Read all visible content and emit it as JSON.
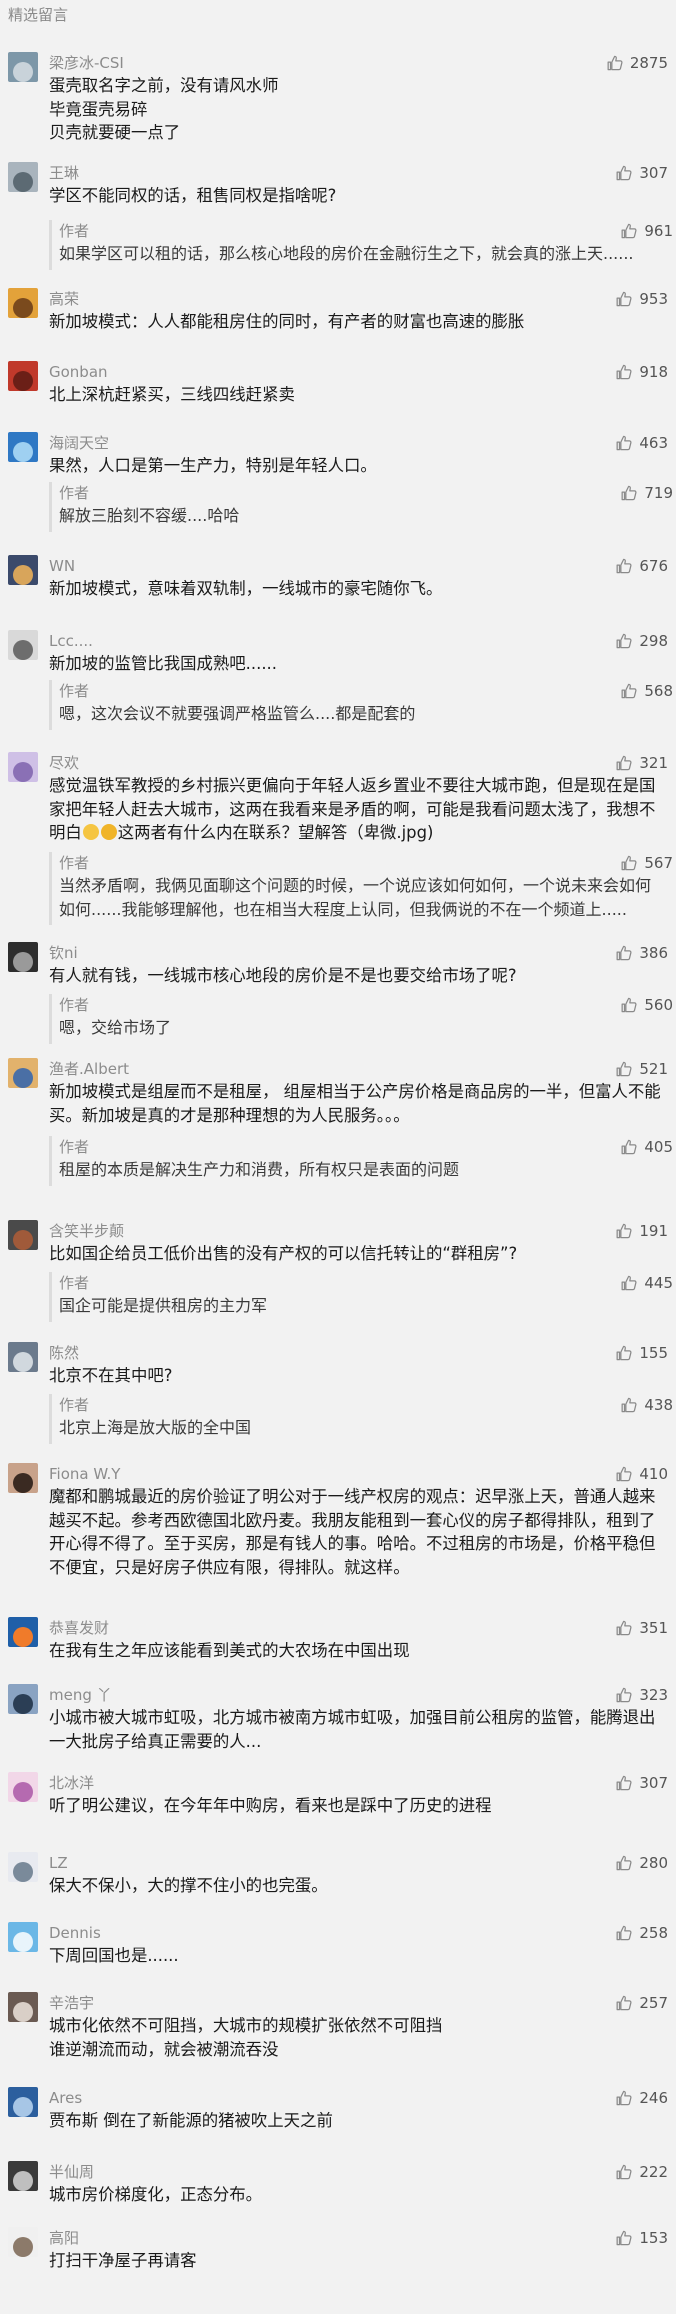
{
  "section_title": "精选留言",
  "comments": [
    {
      "name": "梁彦冰-CSI",
      "likes": "2875",
      "lines": [
        "蛋壳取名字之前，没有请风水师",
        "毕竟蛋壳易碎",
        "贝壳就要硬一点了"
      ]
    },
    {
      "name": "王琳",
      "likes": "307",
      "lines": [
        "学区不能同权的话，租售同权是指啥呢?"
      ],
      "reply": {
        "label": "作者",
        "likes": "961",
        "lines": [
          "如果学区可以租的话，那么核心地段的房价在金融衍生之下，就会真的涨上天......"
        ]
      }
    },
    {
      "name": "高荣",
      "likes": "953",
      "lines": [
        "新加坡模式：人人都能租房住的同时，有产者的财富也高速的膨胀"
      ]
    },
    {
      "name": "Gonban",
      "likes": "918",
      "lines": [
        "北上深杭赶紧买，三线四线赶紧卖"
      ]
    },
    {
      "name": "海阔天空",
      "likes": "463",
      "lines": [
        "果然，人口是第一生产力，特别是年轻人口。"
      ],
      "reply": {
        "label": "作者",
        "likes": "719",
        "lines": [
          "解放三胎刻不容缓....哈哈"
        ]
      }
    },
    {
      "name": "WN",
      "likes": "676",
      "lines": [
        "新加坡模式，意味着双轨制，一线城市的豪宅随你飞。"
      ]
    },
    {
      "name": "Lcc....",
      "likes": "298",
      "lines": [
        "新加坡的监管比我国成熟吧......"
      ],
      "reply": {
        "label": "作者",
        "likes": "568",
        "lines": [
          "嗯，这次会议不就要强调严格监管么....都是配套的"
        ]
      }
    },
    {
      "name": "尽欢",
      "likes": "321",
      "lines": [
        "感觉温铁军教授的乡村振兴更偏向于年轻人返乡置业不要往大城市跑，但是现在是国",
        "家把年轻人赶去大城市，这两在我看来是矛盾的啊，可能是我看问题太浅了，我想不",
        "明白[emoji][emoji]这两者有什么内在联系？望解答（卑微.jpg)"
      ],
      "reply": {
        "label": "作者",
        "likes": "567",
        "lines": [
          "当然矛盾啊，我俩见面聊这个问题的时候，一个说应该如何如何，一个说未来会如何",
          "如何......我能够理解他，也在相当大程度上认同，但我俩说的不在一个频道上....."
        ]
      }
    },
    {
      "name": "钦ni",
      "likes": "386",
      "lines": [
        "有人就有钱，一线城市核心地段的房价是不是也要交给市场了呢?"
      ],
      "reply": {
        "label": "作者",
        "likes": "560",
        "lines": [
          "嗯，交给市场了"
        ]
      }
    },
    {
      "name": "渔者.Albert",
      "likes": "521",
      "lines": [
        "新加坡模式是组屋而不是租屋， 组屋相当于公产房价格是商品房的一半，但富人不能",
        "买。新加坡是真的才是那种理想的为人民服务。。。"
      ],
      "reply": {
        "label": "作者",
        "likes": "405",
        "lines": [
          "租屋的本质是解决生产力和消费，所有权只是表面的问题"
        ]
      }
    },
    {
      "name": "含笑半步颠",
      "likes": "191",
      "lines": [
        "比如国企给员工低价出售的没有产权的可以信托转让的“群租房”?"
      ],
      "reply": {
        "label": "作者",
        "likes": "445",
        "lines": [
          "国企可能是提供租房的主力军"
        ]
      }
    },
    {
      "name": "陈然",
      "likes": "155",
      "lines": [
        "北京不在其中吧?"
      ],
      "reply": {
        "label": "作者",
        "likes": "438",
        "lines": [
          "北京上海是放大版的全中国"
        ]
      }
    },
    {
      "name": "Fiona W.Y",
      "likes": "410",
      "lines": [
        "魔都和鹏城最近的房价验证了明公对于一线产权房的观点：迟早涨上天，普通人越来",
        "越买不起。参考西欧德国北欧丹麦。我朋友能租到一套心仪的房子都得排队，租到了",
        "开心得不得了。至于买房，那是有钱人的事。哈哈。不过租房的市场是，价格平稳但",
        "不便宜，只是好房子供应有限，得排队。就这样。"
      ]
    },
    {
      "name": "恭喜发财",
      "likes": "351",
      "lines": [
        "在我有生之年应该能看到美式的大农场在中国出现"
      ]
    },
    {
      "name": "meng 丫",
      "likes": "323",
      "lines": [
        "小城市被大城市虹吸，北方城市被南方城市虹吸，加强目前公租房的监管，能腾退出",
        "一大批房子给真正需要的人..."
      ]
    },
    {
      "name": "北冰洋",
      "likes": "307",
      "lines": [
        "听了明公建议，在今年年中购房，看来也是踩中了历史的进程"
      ]
    },
    {
      "name": "LZ",
      "likes": "280",
      "lines": [
        "保大不保小，大的撑不住小的也完蛋。"
      ]
    },
    {
      "name": "Dennis",
      "likes": "258",
      "lines": [
        "下周回国也是......"
      ]
    },
    {
      "name": "辛浩宇",
      "likes": "257",
      "lines": [
        "城市化依然不可阻挡，大城市的规模扩张依然不可阻挡",
        "谁逆潮流而动，就会被潮流吞没"
      ]
    },
    {
      "name": "Ares",
      "likes": "246",
      "lines": [
        "贾布斯 倒在了新能源的猪被吹上天之前"
      ]
    },
    {
      "name": "半仙周",
      "likes": "222",
      "lines": [
        "城市房价梯度化，正态分布。"
      ]
    },
    {
      "name": "高阳",
      "likes": "153",
      "lines": [
        "打扫干净屋子再请客"
      ]
    }
  ],
  "colors": {
    "bg": "#f2f2f2",
    "meta": "#8c8c8c",
    "text": "#1a1a1a",
    "reply_bar": "#dcdcdc"
  }
}
